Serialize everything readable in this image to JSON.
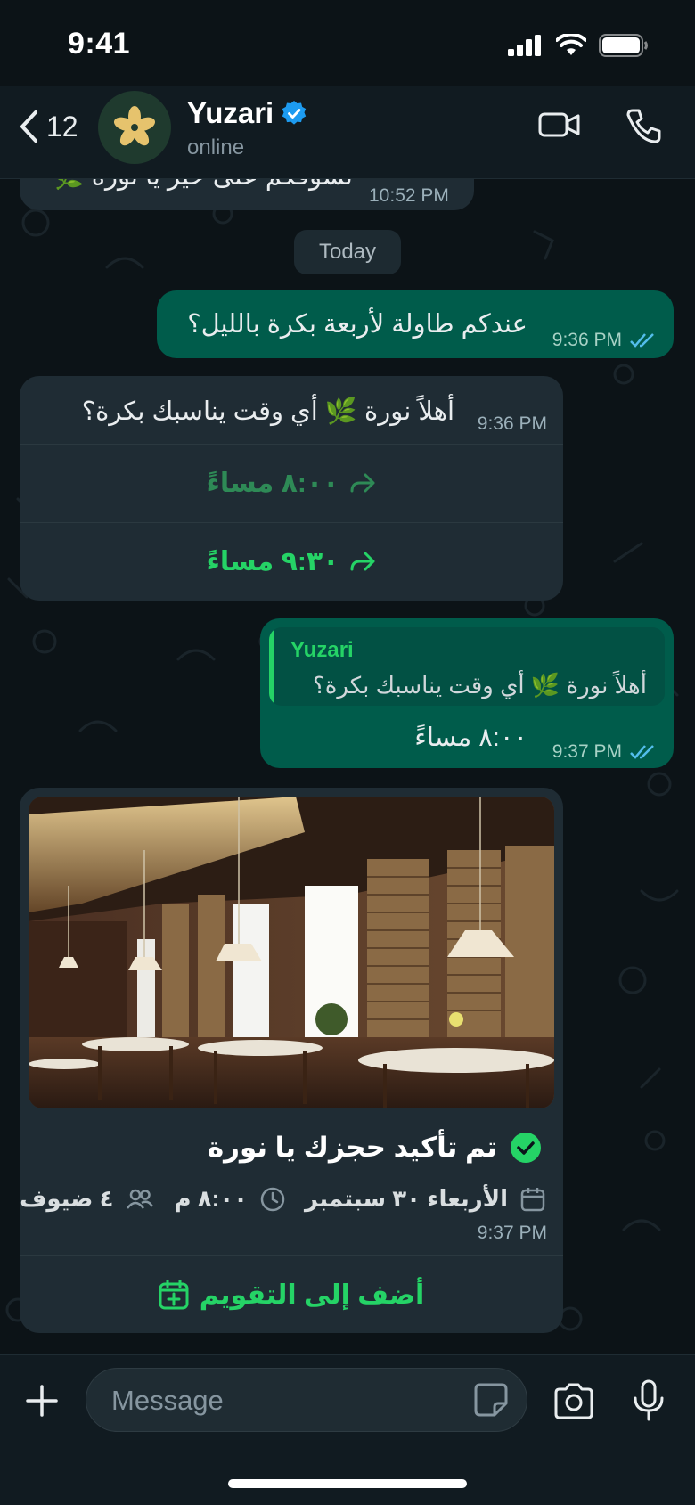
{
  "status_bar": {
    "time": "9:41"
  },
  "header": {
    "back_count": "12",
    "contact_name": "Yuzari",
    "contact_status": "online",
    "verified_icon": "verified-badge-icon",
    "video_icon": "video-camera-icon",
    "call_icon": "phone-icon"
  },
  "messages": {
    "prev": {
      "text": "نشوفكم على خير يا نورة 🌿",
      "time": "10:52 PM"
    },
    "day_separator": "Today",
    "m1": {
      "text": "عندكم طاولة لأربعة بكرة بالليل؟",
      "time": "9:36 PM"
    },
    "m2": {
      "text": "أهلاً نورة 🌿 أي وقت يناسبك بكرة؟",
      "time": "9:36 PM",
      "reply_options": [
        "٨:٠٠ مساءً",
        "٩:٣٠ مساءً"
      ]
    },
    "m3": {
      "quote_name": "Yuzari",
      "quote_text": "أهلاً نورة 🌿 أي وقت يناسبك بكرة؟",
      "text": "٨:٠٠ مساءً",
      "time": "9:37 PM"
    },
    "m4": {
      "title": "تم تأكيد حجزك يا نورة",
      "date": "الأربعاء ٣٠ سبتمبر",
      "time_slot": "٨:٠٠ م",
      "guests": "٤ ضيوف",
      "time": "9:37 PM",
      "action": "أضف إلى التقويم"
    }
  },
  "composer": {
    "placeholder": "Message"
  },
  "colors": {
    "accent": "#25d366",
    "outgoing": "#005c4b",
    "incoming": "#1f2c34",
    "read_ticks": "#53bdeb"
  }
}
